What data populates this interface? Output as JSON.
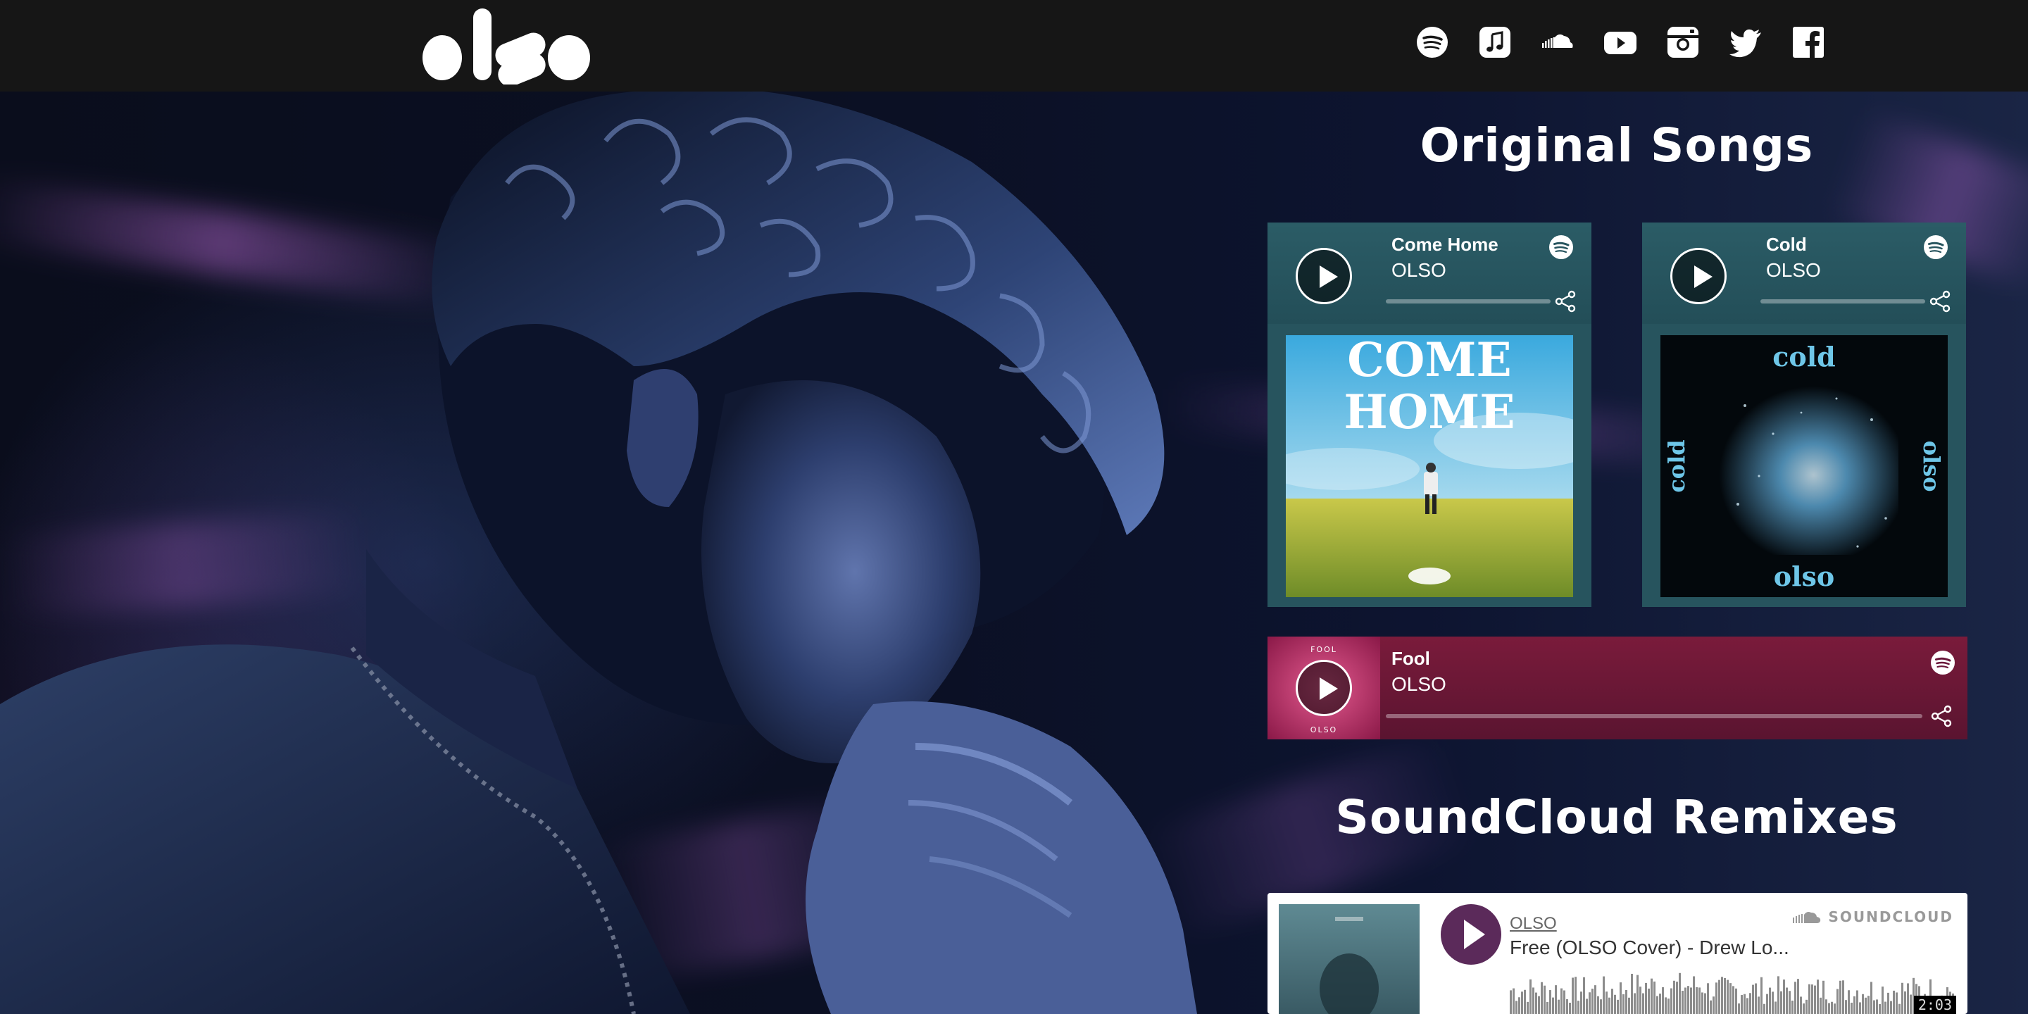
{
  "header": {
    "social": [
      {
        "name": "spotify-icon"
      },
      {
        "name": "apple-music-icon"
      },
      {
        "name": "soundcloud-icon"
      },
      {
        "name": "youtube-icon"
      },
      {
        "name": "instagram-icon"
      },
      {
        "name": "twitter-icon"
      },
      {
        "name": "facebook-icon"
      }
    ]
  },
  "sections": {
    "original_title": "Original Songs",
    "remix_title": "SoundCloud Remixes"
  },
  "tracks": [
    {
      "title": "Come Home",
      "artist": "OLSO",
      "progress": 0
    },
    {
      "title": "Cold",
      "artist": "OLSO",
      "progress": 0
    },
    {
      "title": "Fool",
      "artist": "OLSO",
      "progress": 0
    }
  ],
  "soundcloud": {
    "user": "OLSO",
    "track": "Free (OLSO Cover) - Drew Lo...",
    "brand": "SOUNDCLOUD",
    "time": "2:03"
  },
  "colors": {
    "header_bg": "#161616",
    "card_teal": "#27545e",
    "card_wine": "#6a173a",
    "sc_play": "#5b2a5a"
  }
}
